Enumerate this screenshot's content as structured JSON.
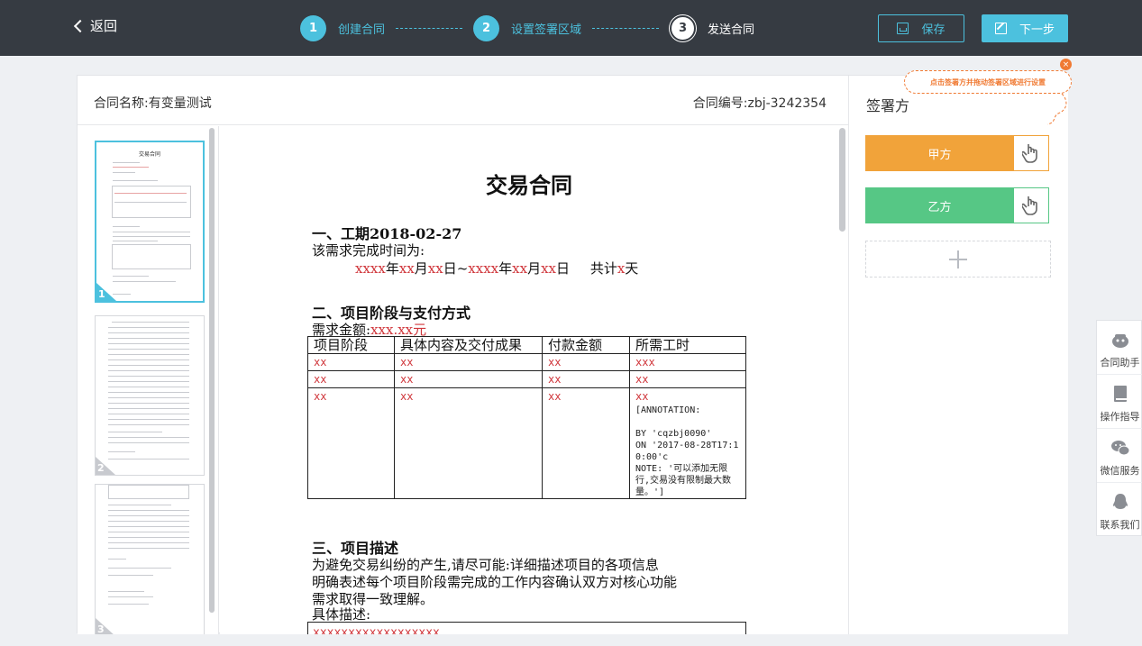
{
  "header": {
    "back_label": "返回",
    "steps": [
      {
        "num": "1",
        "label": "创建合同"
      },
      {
        "num": "2",
        "label": "设置签署区域"
      },
      {
        "num": "3",
        "label": "发送合同"
      }
    ],
    "save_label": "保存",
    "next_label": "下一步"
  },
  "contract": {
    "name_label": "合同名称:有变量测试",
    "number_label": "合同编号:zbj-3242354"
  },
  "thumbnails": [
    {
      "page": "1",
      "title": "交易合同"
    },
    {
      "page": "2"
    },
    {
      "page": "3"
    }
  ],
  "document": {
    "title": "交易合同",
    "section1_heading": "一、工期2018-02-27",
    "section1_text": "该需求完成时间为:",
    "date_range": {
      "y1": "xxxx",
      "n1": "年",
      "m1": "xx",
      "u1": "月",
      "d1": "xx",
      "e1": "日~",
      "y2": "xxxx",
      "n2": "年",
      "m2": "xx",
      "u2": "月",
      "d2": "xx",
      "e2": "日",
      "total_prefix": "共计",
      "total_val": "x",
      "total_unit": "天"
    },
    "section2_heading": "二、项目阶段与支付方式",
    "amount_label": "需求金额:",
    "amount_value": "xxx.xx元",
    "table": {
      "headers": [
        "项目阶段",
        "具体内容及交付成果",
        "付款金额",
        "所需工时"
      ],
      "rows": [
        [
          "xx",
          "xx",
          "xx",
          "xxx"
        ],
        [
          "xx",
          "xx",
          "xx",
          "xx"
        ],
        [
          "xx",
          "xx",
          "xx",
          "xx"
        ]
      ],
      "annotation": "[ANNOTATION:\n\nBY 'cqzbj0090'\nON '2017-08-28T17:10:00'c\nNOTE: '可以添加无限行,交易没有限制最大数量。']"
    },
    "section3_heading": "三、项目描述",
    "section3_text_line1": "为避免交易纠纷的产生,请尽可能:详细描述项目的各项信息",
    "section3_text_line2": "明确表述每个项目阶段需完成的工作内容确认双方对核心功能",
    "section3_text_line3": "需求取得一致理解。",
    "desc_label": "具体描述:",
    "desc_value": "xxxxxxxxxxxxxxxxxx"
  },
  "sign_panel": {
    "title": "签署方",
    "parties": [
      {
        "label": "甲方",
        "color": "#f1a33a"
      },
      {
        "label": "乙方",
        "color": "#56c785"
      }
    ],
    "tooltip": "点击签署方并拖动签署区域进行设置"
  },
  "side_tools": [
    {
      "label": "合同助手",
      "icon": "robot-icon"
    },
    {
      "label": "操作指导",
      "icon": "book-icon"
    },
    {
      "label": "微信服务",
      "icon": "wechat-icon"
    },
    {
      "label": "联系我们",
      "icon": "qq-icon"
    }
  ],
  "colors": {
    "accent": "#4cc1de",
    "topbar": "#363b42",
    "party_a": "#f1a33a",
    "party_b": "#56c785",
    "tooltip": "#f07a33",
    "variable_red": "#d0363b"
  }
}
